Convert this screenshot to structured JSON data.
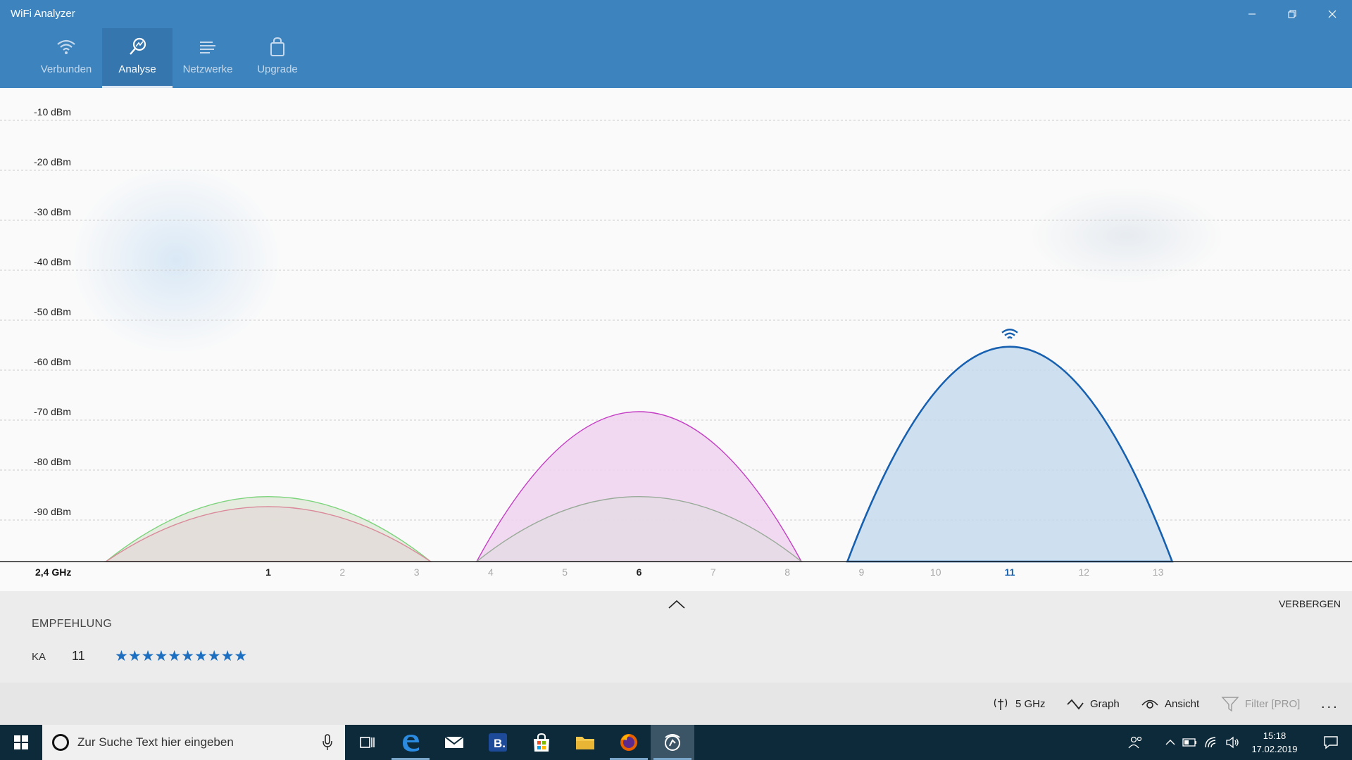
{
  "window": {
    "title": "WiFi Analyzer"
  },
  "nav": {
    "tabs": [
      {
        "label": "Verbunden",
        "icon": "wifi-icon"
      },
      {
        "label": "Analyse",
        "icon": "analysis-icon"
      },
      {
        "label": "Netzwerke",
        "icon": "list-icon"
      },
      {
        "label": "Upgrade",
        "icon": "shopping-bag-icon"
      }
    ],
    "active_tab": "Analyse"
  },
  "chart_data": {
    "type": "area",
    "band_label": "2,4 GHz",
    "y_labels": [
      "-10 dBm",
      "-20 dBm",
      "-30 dBm",
      "-40 dBm",
      "-50 dBm",
      "-60 dBm",
      "-70 dBm",
      "-80 dBm",
      "-90 dBm"
    ],
    "ylim": [
      -100,
      0
    ],
    "x_channels": [
      1,
      2,
      3,
      4,
      5,
      6,
      7,
      8,
      9,
      10,
      11,
      12,
      13
    ],
    "bold_channels": [
      1,
      6,
      11
    ],
    "highlight_channel": 11,
    "grid": true,
    "networks": [
      {
        "channel": 1,
        "signal_dbm": -87,
        "color": "#7cd47c",
        "fill": "#e2e8d9"
      },
      {
        "channel": 1,
        "signal_dbm": -89,
        "color": "#d9899a",
        "fill": "#e2dcd8"
      },
      {
        "channel": 6,
        "signal_dbm": -70,
        "color": "#c43fc4",
        "fill": "#efd3ef"
      },
      {
        "channel": 6,
        "signal_dbm": -87,
        "color": "#9aaa9a",
        "fill": "#e4dbe4"
      },
      {
        "channel": 11,
        "signal_dbm": -57,
        "color": "#1760b0",
        "fill": "#c5dbec",
        "connected": true
      }
    ],
    "colors": {
      "connected": "#1760b0",
      "axis": "#222222",
      "grid": "#cccccc"
    }
  },
  "recommendation": {
    "hide_label": "VERBERGEN",
    "title": "EMPFEHLUNG",
    "channel_label": "KA",
    "channel_value": "11",
    "stars": "★★★★★★★★★★",
    "star_count": 10
  },
  "command_bar": {
    "band": "5 GHz",
    "graph": "Graph",
    "view": "Ansicht",
    "filter": "Filter [PRO]",
    "more": "..."
  },
  "taskbar": {
    "search_placeholder": "Zur Suche Text hier eingeben",
    "time": "15:18",
    "date": "17.02.2019",
    "apps": [
      "task-view",
      "edge",
      "mail",
      "booking",
      "store",
      "file-explorer",
      "firefox",
      "wifi-analyzer"
    ]
  }
}
